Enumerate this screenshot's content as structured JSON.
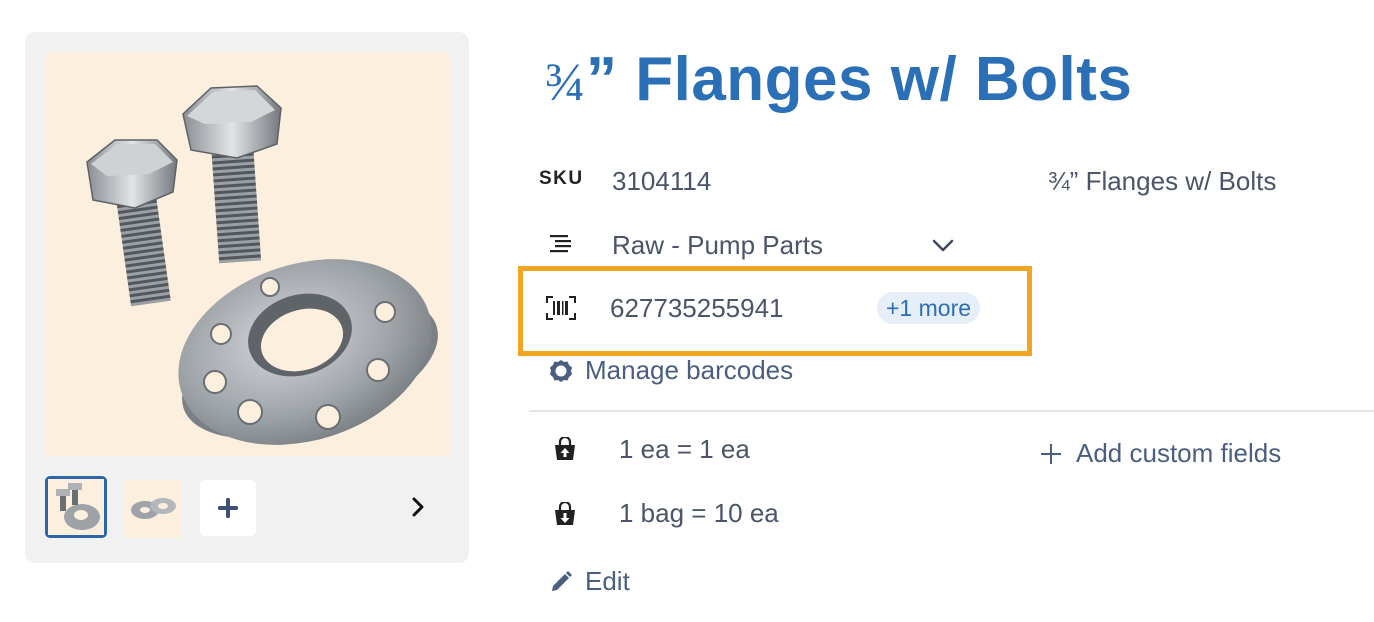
{
  "product": {
    "title_fraction": "¾",
    "title_rest": "” Flanges w/ Bolts",
    "sku_label": "SKU",
    "sku_value": "3104114",
    "description": "¾” Flanges w/ Bolts",
    "category": "Raw - Pump Parts",
    "barcode": "627735255941",
    "barcode_more": "+1 more",
    "manage_barcodes": "Manage barcodes",
    "uom_base": "1 ea = 1 ea",
    "uom_bag": "1 bag = 10 ea",
    "add_custom_fields": "Add custom fields",
    "edit": "Edit"
  },
  "gallery": {
    "images": [
      "flanges-with-bolts-photo",
      "flange-washers-photo"
    ],
    "selected_index": 0
  },
  "icons": {
    "category": "list-indent-icon",
    "chevron": "chevron-down-icon",
    "barcode": "barcode-scan-icon",
    "manage": "gear-icon",
    "uom_up": "bag-arrow-up-icon",
    "uom_down": "bag-arrow-down-icon",
    "add": "plus-icon",
    "edit": "pencil-icon",
    "next": "chevron-right-icon"
  },
  "colors": {
    "title": "#2b6fb6",
    "highlight": "#f2a523",
    "link": "#4b5e80",
    "hero_bg": "#fcefdd"
  }
}
